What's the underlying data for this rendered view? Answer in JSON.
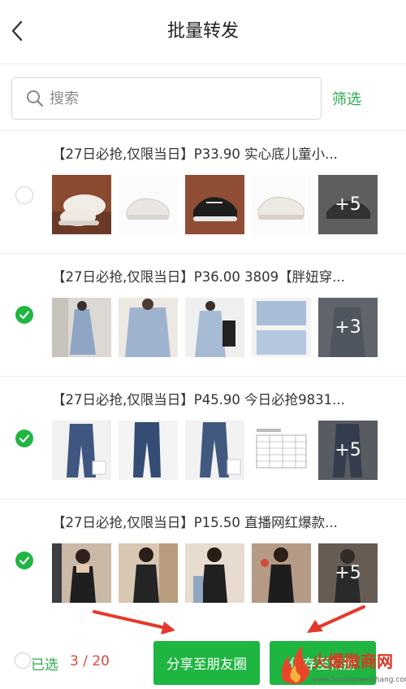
{
  "header": {
    "title": "批量转发"
  },
  "search": {
    "placeholder": "搜索",
    "filter_label": "筛选"
  },
  "items": [
    {
      "title": "【27日必抢,仅限当日】P33.90 实心底儿童小...",
      "checked": false,
      "more": "+5"
    },
    {
      "title": "【27日必抢,仅限当日】P36.00 3809【胖妞穿...",
      "checked": true,
      "more": "+3"
    },
    {
      "title": "【27日必抢,仅限当日】P45.90 今日必抢9831...",
      "checked": true,
      "more": "+5"
    },
    {
      "title": "【27日必抢,仅限当日】P15.50 直播网红爆款...",
      "checked": true,
      "more": "+5"
    }
  ],
  "footer": {
    "selected_label": "已选",
    "count": "3 / 20",
    "share_moments_label": "分享至朋友圈",
    "save_album_label": "保存至相册"
  },
  "watermark": {
    "text": "火爆微商网",
    "url": "www.huobaoweishang.com"
  },
  "colors": {
    "accent": "#1fb541",
    "count": "#e1473f",
    "arrow": "#e33a2c"
  }
}
